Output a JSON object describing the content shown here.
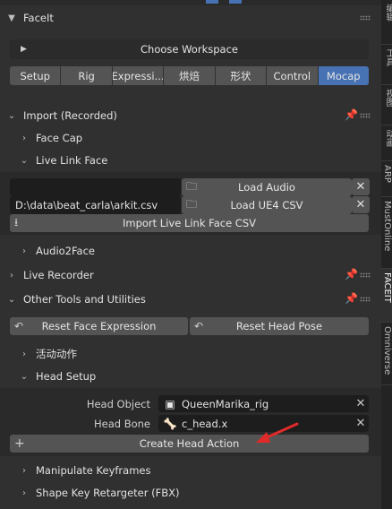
{
  "panel": {
    "title": "FaceIt",
    "choose_workspace": "Choose Workspace",
    "tabs": [
      {
        "label": "Setup",
        "active": false
      },
      {
        "label": "Rig",
        "active": false
      },
      {
        "label": "Expressi...",
        "active": false
      },
      {
        "label": "烘焙",
        "active": false
      },
      {
        "label": "形状",
        "active": false
      },
      {
        "label": "Control",
        "active": false
      },
      {
        "label": "Mocap",
        "active": true
      }
    ]
  },
  "import": {
    "title": "Import (Recorded)",
    "face_cap": "Face Cap",
    "live_link_face": "Live Link Face",
    "audio_path": "",
    "csv_path": "D:\\data\\beat_carla\\arkit.csv",
    "load_audio": "Load Audio",
    "load_ue4_csv": "Load UE4 CSV",
    "import_csv": "Import Live Link Face CSV",
    "audio2face": "Audio2Face"
  },
  "live_recorder": {
    "title": "Live Recorder"
  },
  "other_tools": {
    "title": "Other Tools and Utilities",
    "reset_face": "Reset Face Expression",
    "reset_head": "Reset Head Pose",
    "activity": "活动动作",
    "head_setup": "Head Setup",
    "head_object_label": "Head Object",
    "head_object_value": "QueenMarika_rig",
    "head_bone_label": "Head Bone",
    "head_bone_value": "c_head.x",
    "create_head_action": "Create Head Action",
    "manipulate_keyframes": "Manipulate Keyframes",
    "shape_key_retargeter": "Shape Key Retargeter (FBX)"
  },
  "side_tabs": [
    "编辑",
    "工具",
    "视图",
    "动画",
    "ARP",
    "MustOnline",
    "FACEIT",
    "Omniverse"
  ],
  "colors": {
    "accent": "#4772b3",
    "arrow": "#e02a2a"
  }
}
